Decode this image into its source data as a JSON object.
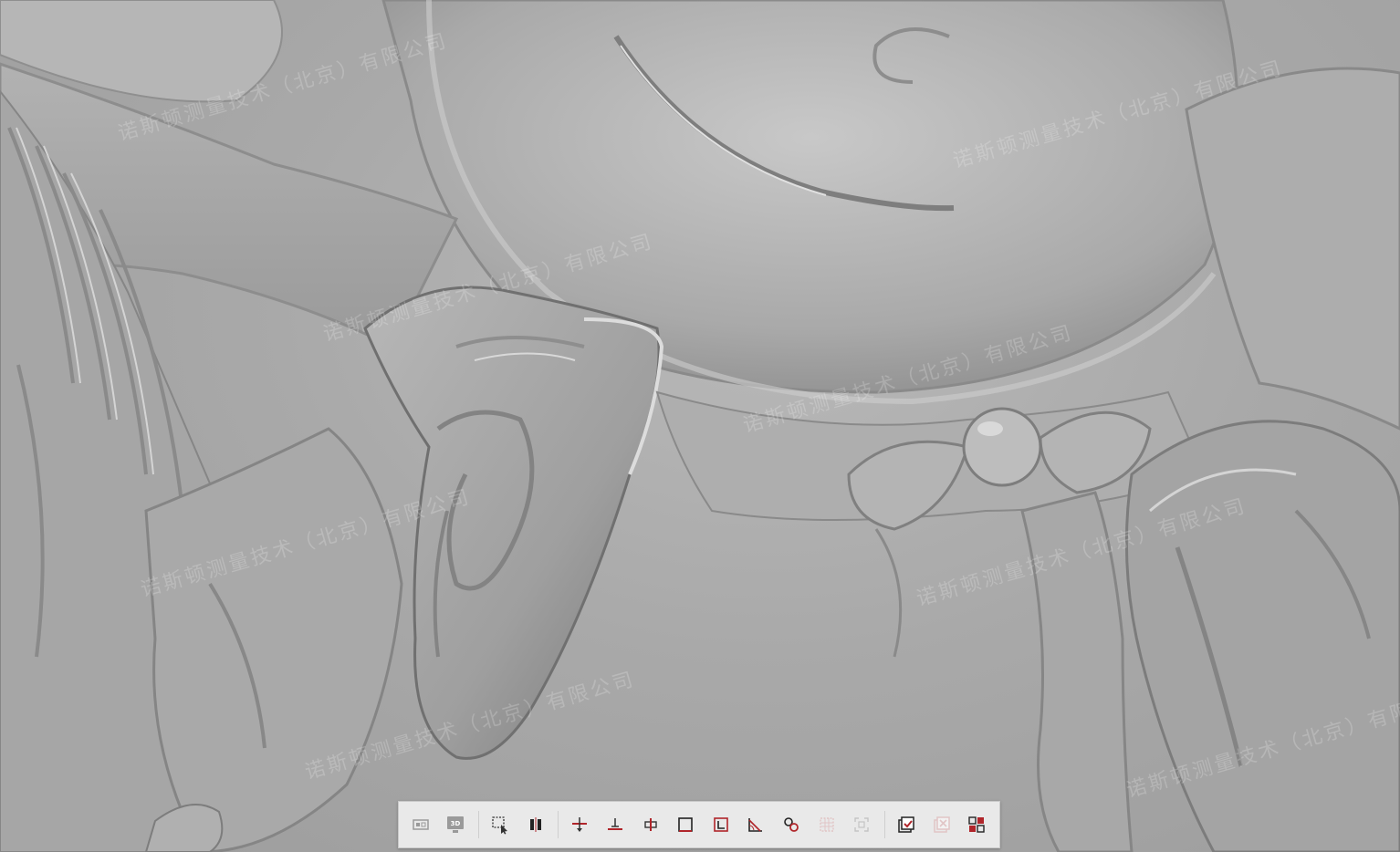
{
  "viewport": {
    "background_color": "#a8a8a8",
    "watermarks": [
      "诺斯顿测量技术（北京）有限公司",
      "诺斯顿测量技术（北京）有限公司",
      "诺斯顿测量技术（北京）有限公司",
      "诺斯顿测量技术（北京）有限公司",
      "诺斯顿测量技术（北京）有限公司",
      "诺斯顿测量技术（北京）有限公司",
      "诺斯顿测量技术（北京）有限公司",
      "诺斯顿测量技术（北京）有限公司"
    ]
  },
  "toolbar": {
    "accent_color": "#b0252a",
    "disabled_color": "#d99a9c",
    "buttons": [
      {
        "icon": "view-2d-icon",
        "state": "enabled"
      },
      {
        "icon": "view-3d-icon",
        "state": "enabled",
        "label": "3D"
      },
      {
        "icon": "select-region-icon",
        "state": "enabled"
      },
      {
        "icon": "split-view-icon",
        "state": "enabled"
      },
      {
        "icon": "move-down-icon",
        "state": "enabled"
      },
      {
        "icon": "align-plane-icon",
        "state": "enabled"
      },
      {
        "icon": "section-icon",
        "state": "enabled"
      },
      {
        "icon": "square-frame-icon",
        "state": "enabled"
      },
      {
        "icon": "corner-frame-icon",
        "state": "enabled"
      },
      {
        "icon": "angle-measure-icon",
        "state": "enabled"
      },
      {
        "icon": "link-points-icon",
        "state": "enabled"
      },
      {
        "icon": "grid-select-icon",
        "state": "disabled"
      },
      {
        "icon": "fit-view-icon",
        "state": "disabled"
      },
      {
        "icon": "confirm-icon",
        "state": "enabled"
      },
      {
        "icon": "cancel-icon",
        "state": "disabled"
      },
      {
        "icon": "swap-layout-icon",
        "state": "enabled"
      }
    ]
  }
}
